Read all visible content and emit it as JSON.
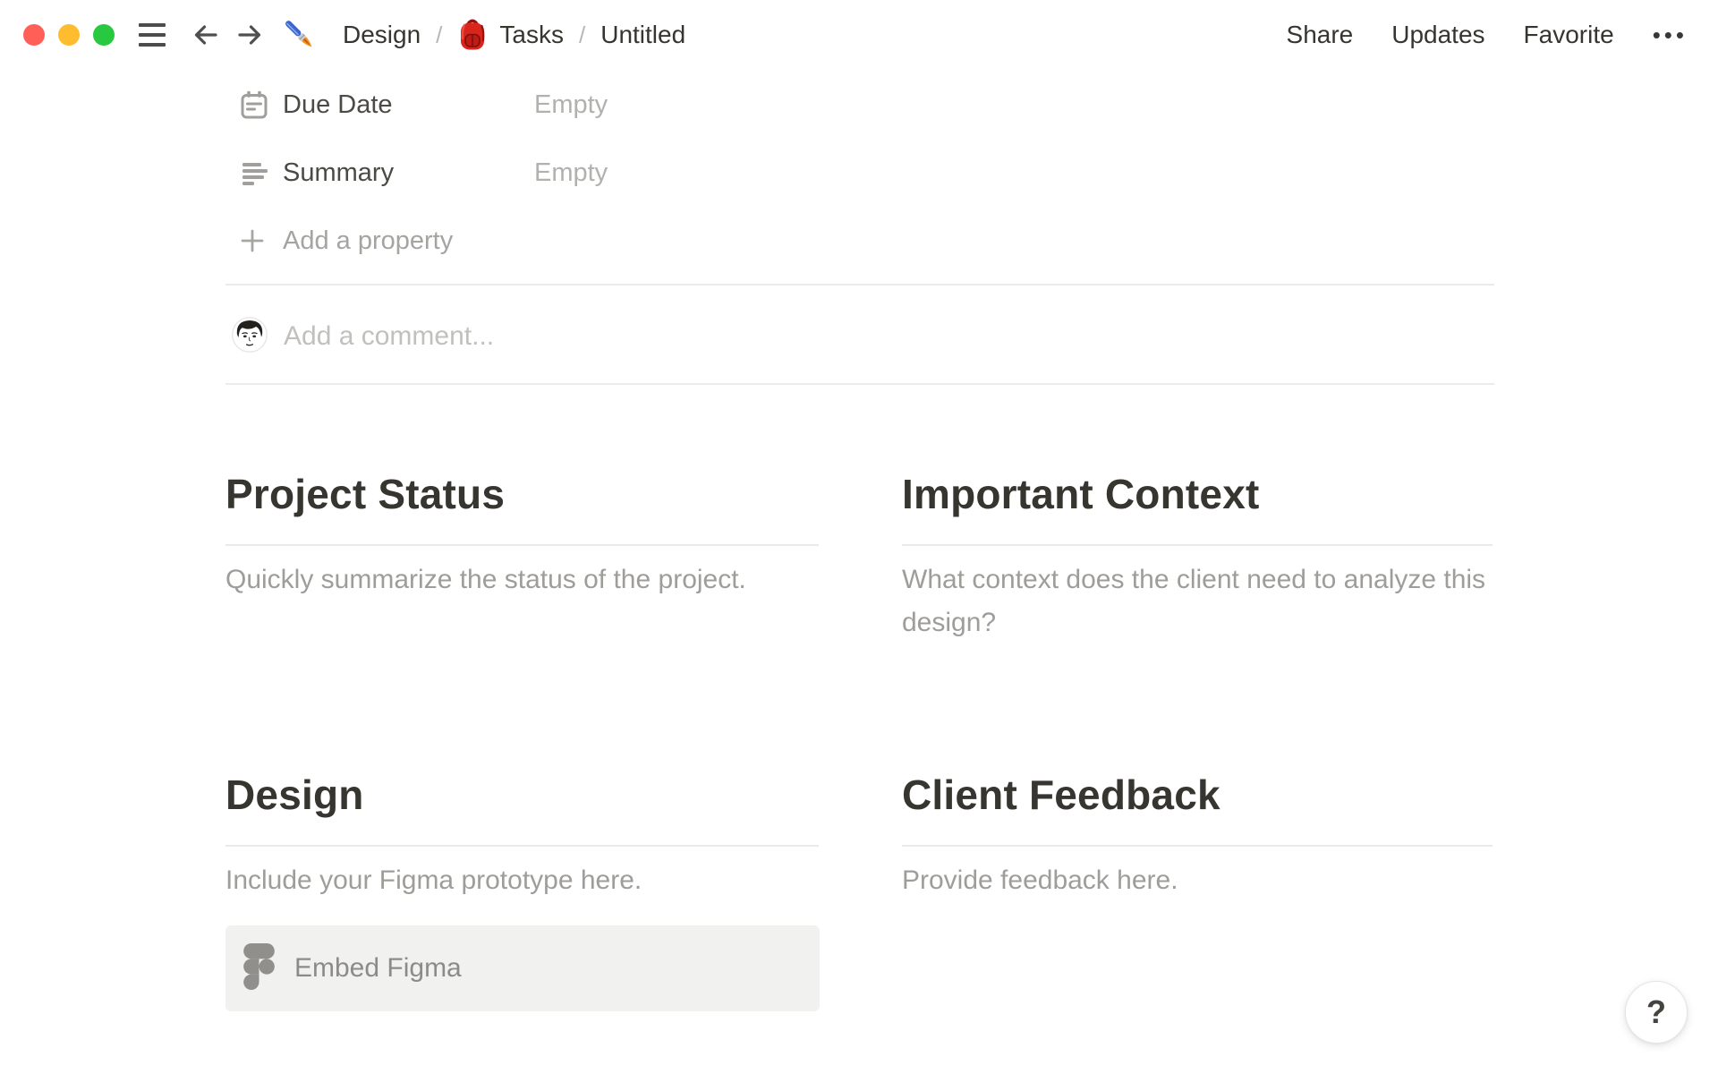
{
  "topbar": {
    "separator": "/",
    "breadcrumb": [
      {
        "icon": "paintbrush-icon",
        "label": "Design"
      },
      {
        "icon": "backpack-icon",
        "label": "Tasks"
      },
      {
        "icon": null,
        "label": "Untitled"
      }
    ],
    "actions": {
      "share": "Share",
      "updates": "Updates",
      "favorite": "Favorite",
      "more": "•••"
    }
  },
  "properties": {
    "rows": [
      {
        "icon": "calendar-icon",
        "label": "Due Date",
        "value": "Empty"
      },
      {
        "icon": "text-lines-icon",
        "label": "Summary",
        "value": "Empty"
      }
    ],
    "add_property": "Add a property"
  },
  "comments": {
    "placeholder": "Add a comment...",
    "avatar": "user-avatar"
  },
  "sections": {
    "project_status": {
      "title": "Project Status",
      "body": "Quickly summarize the status of the project."
    },
    "important_context": {
      "title": "Important Context",
      "body": "What context does the client need to analyze this design?"
    },
    "design": {
      "title": "Design",
      "body": "Include your Figma prototype here.",
      "embed_label": "Embed Figma",
      "embed_icon": "figma-icon"
    },
    "client_feedback": {
      "title": "Client Feedback",
      "body": "Provide feedback here."
    }
  },
  "help_button": {
    "label": "?"
  },
  "colors": {
    "text_primary": "#37352f",
    "text_property_label": "#4c4a45",
    "text_placeholder": "#b2b1ae",
    "text_muted": "#9e9d99",
    "divider": "#ecebe9",
    "embed_background": "#f1f1ef",
    "traffic_red": "#ff5f57",
    "traffic_yellow": "#febc2e",
    "traffic_green": "#28c840"
  }
}
